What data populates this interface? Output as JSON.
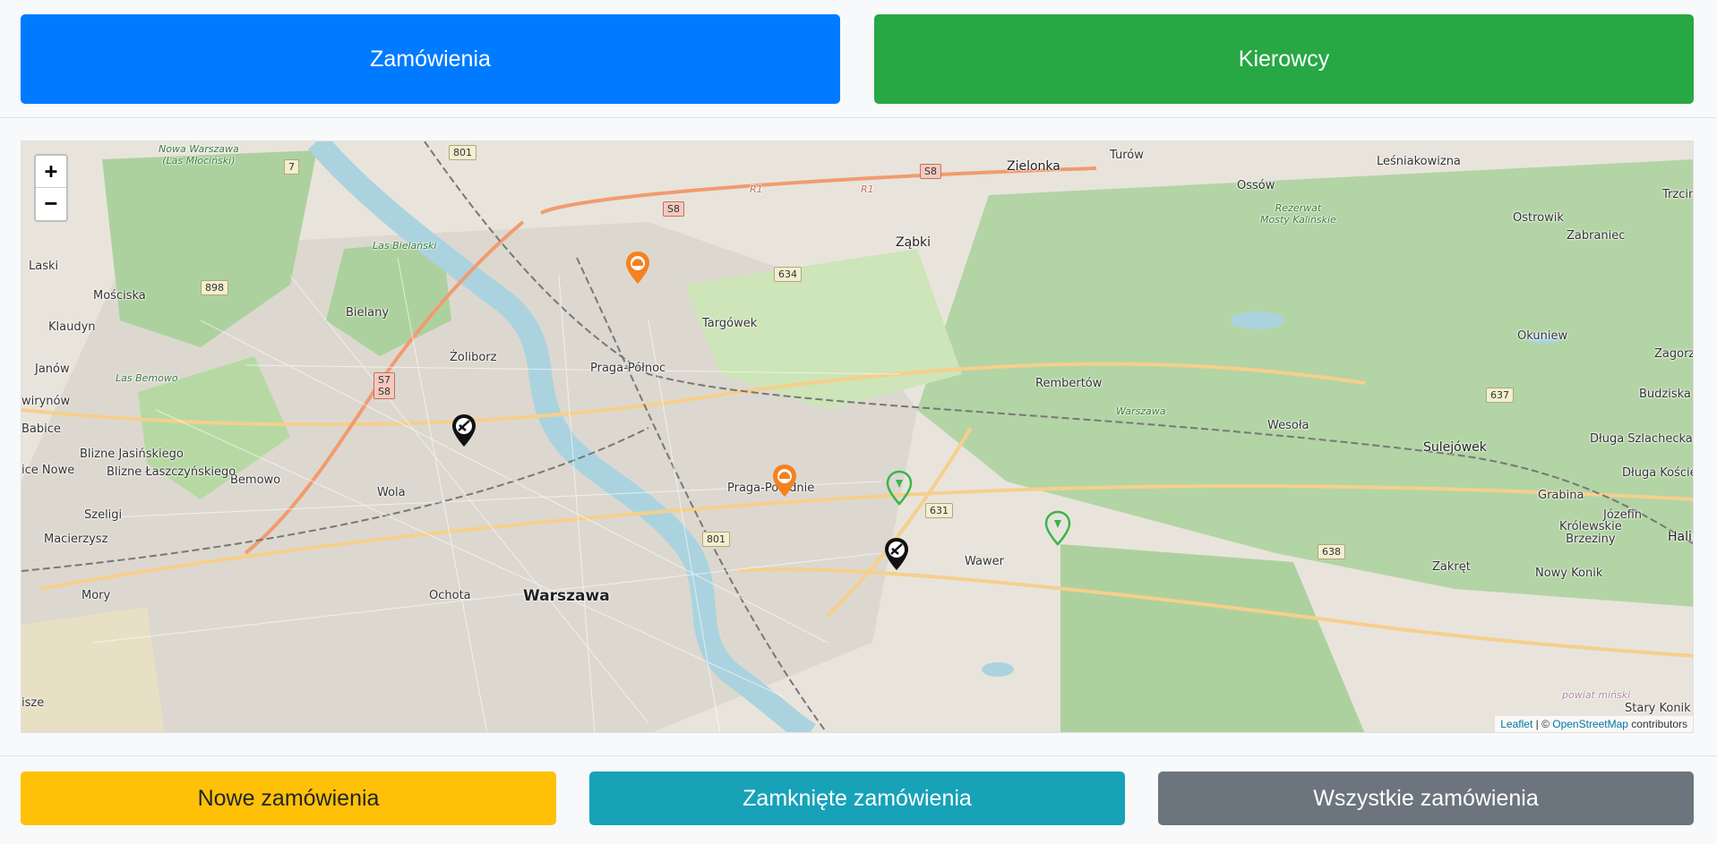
{
  "top_buttons": {
    "orders": "Zamówienia",
    "drivers": "Kierowcy"
  },
  "map": {
    "zoom_in": "+",
    "zoom_out": "−",
    "attribution": {
      "leaflet": "Leaflet",
      "separator": " | © ",
      "osm": "OpenStreetMap",
      "suffix": " contributors"
    },
    "places": {
      "warszawa": "Warszawa",
      "zielonka": "Zielonka",
      "zabki": "Ząbki",
      "targowek": "Targówek",
      "praga_polnoc": "Praga-Północ",
      "praga_poludnie": "Praga-Południe",
      "zoliborz": "Żoliborz",
      "bielany": "Bielany",
      "bemowo": "Bemowo",
      "wola": "Wola",
      "ochota": "Ochota",
      "mory": "Mory",
      "wawer": "Wawer",
      "wesola": "Wesoła",
      "rembertow": "Rembertów",
      "sulejowek": "Sulejówek",
      "okuniew": "Okuniew",
      "turow": "Turów",
      "ossow": "Ossów",
      "lesniakowizna": "Leśniakowizna",
      "ostrowik": "Ostrowik",
      "zabraniec": "Zabraniec",
      "trzcin": "Trzcin",
      "zagorze": "Zagorze",
      "budziska": "Budziska",
      "dluga_szlachecka": "Długa Szlachecka",
      "dluga_koscielna": "Długa Kościel",
      "grabina": "Grabina",
      "jozefin": "Józefin",
      "krolewskie": "Królewskie\nBrzeziny",
      "halin": "Halin",
      "zakret": "Zakręt",
      "nowy_konik": "Nowy Konik",
      "stary_konik": "Stary Konik",
      "laski": "Laski",
      "mosciska": "Mościska",
      "klaudyn": "Klaudyn",
      "janow": "Janów",
      "wirynow": "wirynów",
      "babice": "Babice",
      "blizne_jas": "Blizne Jasińskiego",
      "blizne_lasz": "Blizne Łaszczyńskiego",
      "nowe": "ice Nowe",
      "szeligi": "Szeligi",
      "macierzysz": "Macierzysz",
      "isze": "isze",
      "las_bielanski": "Las Bielański",
      "las_bemowo": "Las Bemowo",
      "nowa_warszawa": "Nowa Warszawa\n(Las Młociński)",
      "rezerwat": "Rezerwat\nMosty Kalińskie",
      "warszawa_forest": "Warszawa",
      "powiat": "powiat miński",
      "r1a": "R1",
      "r1b": "R1"
    },
    "shields": {
      "s801a": "801",
      "s7": "7",
      "s8a": "S8",
      "s8b": "S8",
      "s634": "634",
      "s898": "898",
      "s7s8": "S7\nS8",
      "s631": "631",
      "s801b": "801",
      "s637": "637",
      "s638": "638"
    },
    "markers": {
      "orange": "#f5821f",
      "green": "#3ab54a",
      "black": "#111111"
    }
  },
  "bottom_buttons": {
    "new_orders": "Nowe zamówienia",
    "closed_orders": "Zamknięte zamówienia",
    "all_orders": "Wszystkie zamówienia"
  }
}
